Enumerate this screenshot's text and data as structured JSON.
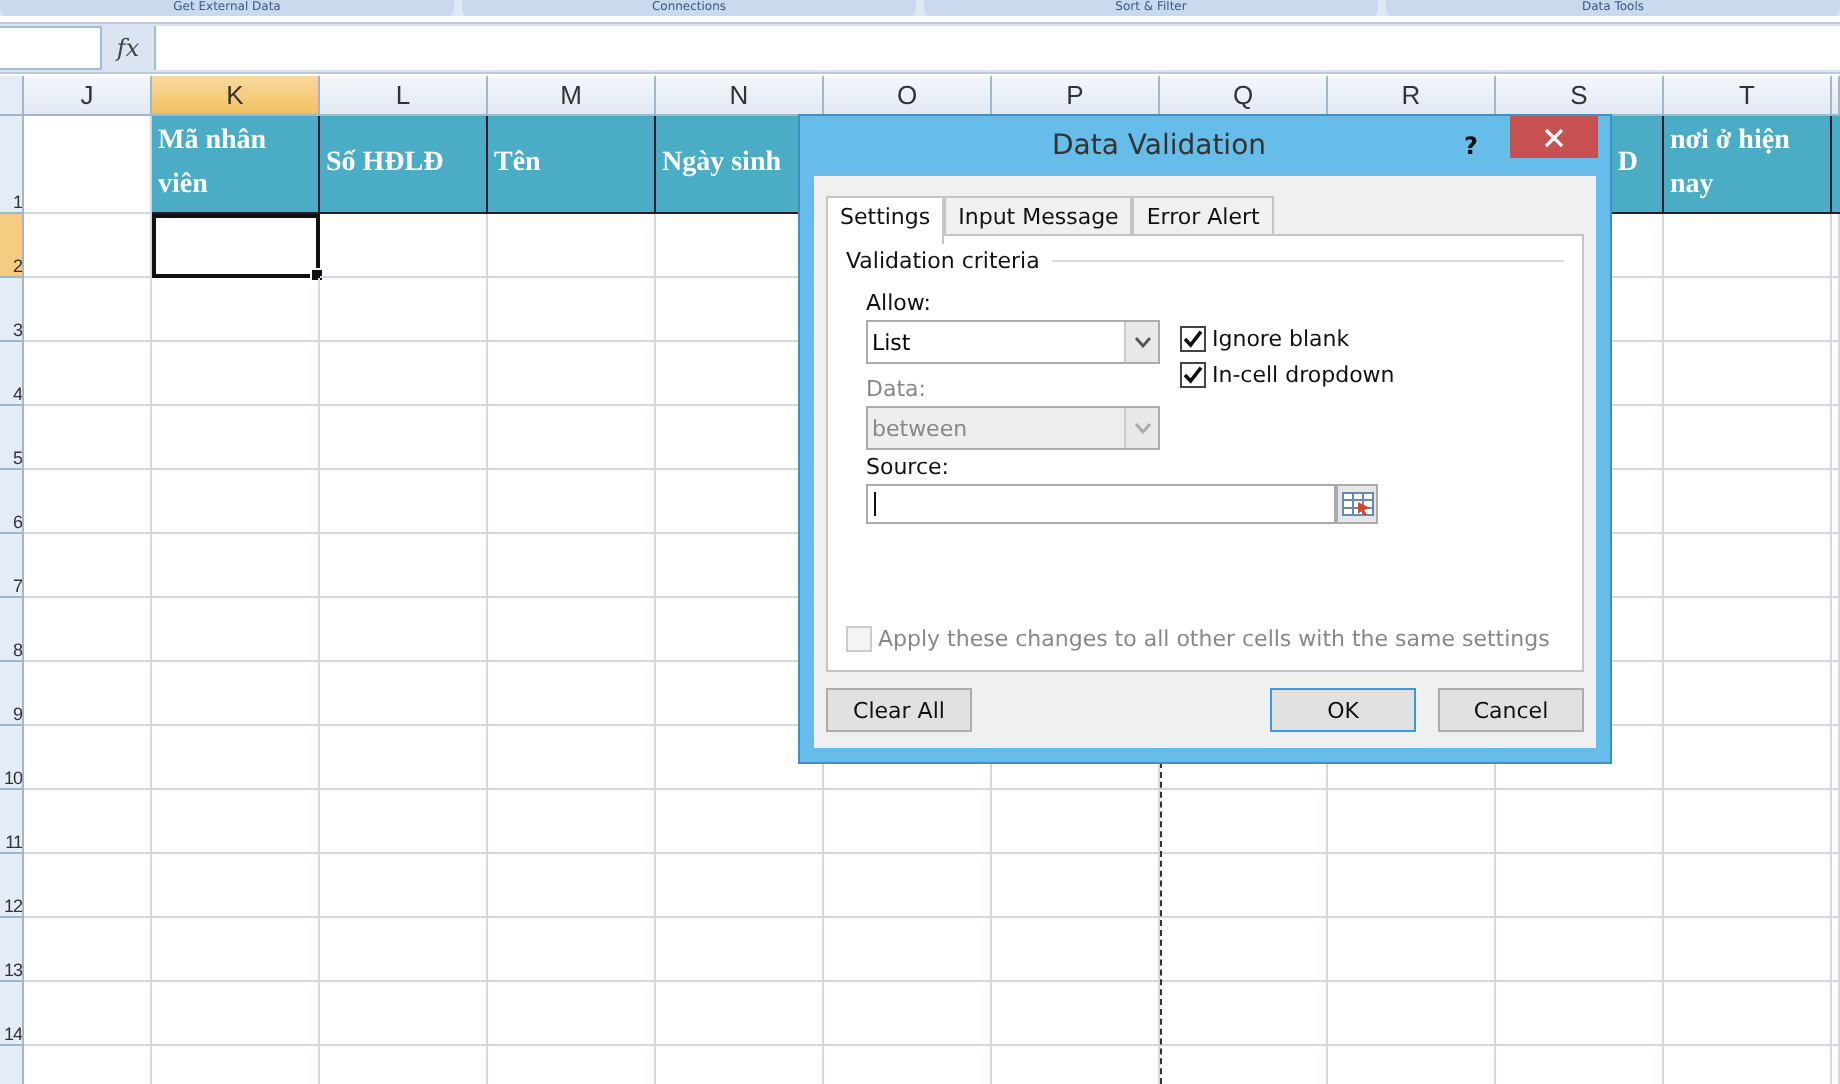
{
  "ribbon_groups": [
    "Get External Data",
    "Connections",
    "Sort & Filter",
    "Data Tools"
  ],
  "formula_bar": {
    "function_label": "fx"
  },
  "columns": [
    {
      "label": "J",
      "selected": false
    },
    {
      "label": "K",
      "selected": true,
      "heading": "Mã nhân viên"
    },
    {
      "label": "L",
      "selected": false,
      "heading": "Số HĐLĐ"
    },
    {
      "label": "M",
      "selected": false,
      "heading": "Tên"
    },
    {
      "label": "N",
      "selected": false,
      "heading": "Ngày sinh"
    },
    {
      "label": "O",
      "selected": false
    },
    {
      "label": "P",
      "selected": false
    },
    {
      "label": "Q",
      "selected": false
    },
    {
      "label": "R",
      "selected": false
    },
    {
      "label": "S",
      "selected": false,
      "heading": "D",
      "heading_cut_left": true
    },
    {
      "label": "T",
      "selected": false,
      "heading": "nơi ở hiện nay"
    }
  ],
  "rows": [
    {
      "label": "1",
      "selected": false
    },
    {
      "label": "2",
      "selected": true
    },
    {
      "label": "3",
      "selected": false
    },
    {
      "label": "4",
      "selected": false
    },
    {
      "label": "5",
      "selected": false
    },
    {
      "label": "6",
      "selected": false
    },
    {
      "label": "7",
      "selected": false
    },
    {
      "label": "8",
      "selected": false
    },
    {
      "label": "9",
      "selected": false
    },
    {
      "label": "10",
      "selected": false
    },
    {
      "label": "11",
      "selected": false
    },
    {
      "label": "12",
      "selected": false
    },
    {
      "label": "13",
      "selected": false
    },
    {
      "label": "14",
      "selected": false
    }
  ],
  "dialog": {
    "title": "Data Validation",
    "help": "?",
    "tabs": [
      {
        "label": "Settings",
        "selected": true
      },
      {
        "label": "Input Message",
        "selected": false
      },
      {
        "label": "Error Alert",
        "selected": false
      }
    ],
    "group_title": "Validation criteria",
    "allow": {
      "label": "Allow:",
      "value": "List",
      "disabled": false
    },
    "data": {
      "label": "Data:",
      "value": "between",
      "disabled": true
    },
    "checkboxes": [
      {
        "label": "Ignore blank",
        "checked": true
      },
      {
        "label": "In-cell dropdown",
        "checked": true
      }
    ],
    "source": {
      "label": "Source:"
    },
    "apply_all": {
      "label": "Apply these changes to all other cells with the same settings",
      "checked": false,
      "disabled": true
    },
    "buttons": [
      {
        "label": "Clear All",
        "default": false
      },
      {
        "label": "OK",
        "default": true
      },
      {
        "label": "Cancel",
        "default": false
      }
    ]
  }
}
